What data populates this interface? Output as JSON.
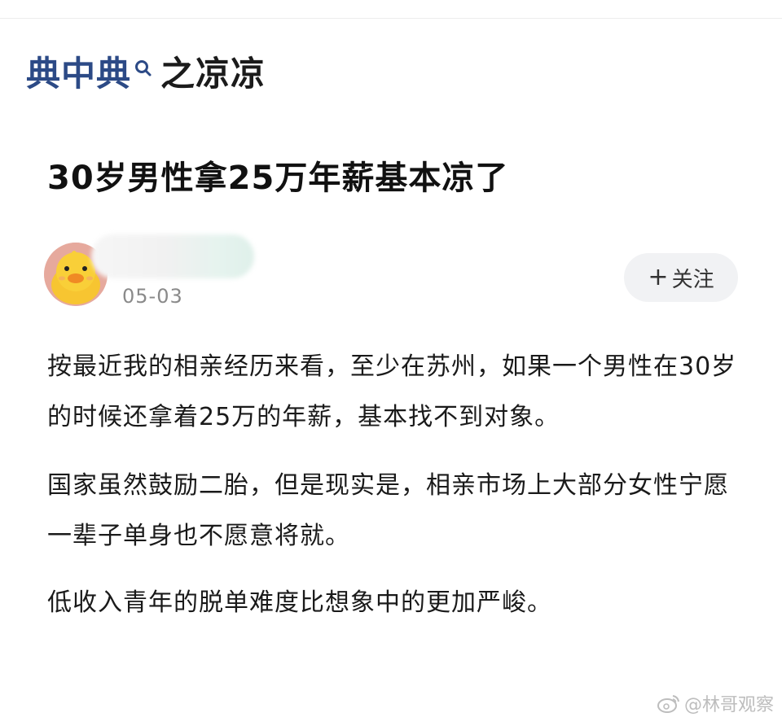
{
  "brand": {
    "part1": "典中典",
    "part2": "之凉凉",
    "search_icon": "search-icon"
  },
  "article": {
    "title": "30岁男性拿25万年薪基本凉了",
    "author": {
      "avatar_icon": "duck-avatar",
      "date": "05-03"
    },
    "follow_label": "关注",
    "paragraphs": [
      "按最近我的相亲经历来看，至少在苏州，如果一个男性在30岁的时候还拿着25万的年薪，基本找不到对象。",
      "国家虽然鼓励二胎，但是现实是，相亲市场上大部分女性宁愿一辈子单身也不愿意将就。",
      "低收入青年的脱单难度比想象中的更加严峻。"
    ]
  },
  "watermark": {
    "text": "@林哥观察",
    "icon": "weibo-icon"
  },
  "colors": {
    "brand_blue": "#2c4a86",
    "text": "#1a1a1a",
    "muted": "#8a8a8a",
    "button_bg": "#f1f2f4"
  }
}
